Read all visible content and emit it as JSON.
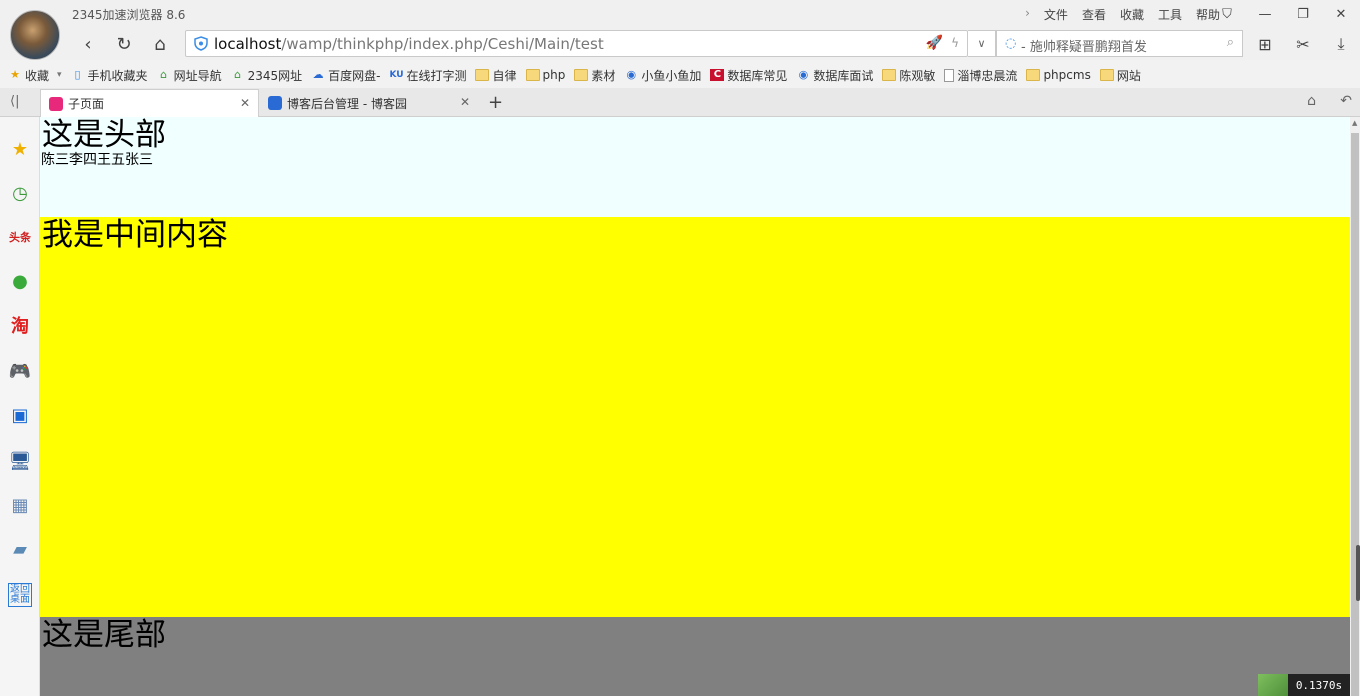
{
  "app": {
    "title": "2345加速浏览器 8.6",
    "menu": [
      "文件",
      "查看",
      "收藏",
      "工具",
      "帮助"
    ],
    "window_controls": [
      "shirt-icon",
      "minimize-icon",
      "restore-icon",
      "close-icon"
    ]
  },
  "nav": {
    "url_host": "localhost",
    "url_path": "/wamp/thinkphp/index.php/Ceshi/Main/test",
    "search_placeholder": "- 施帅释疑晋鹏翔首发"
  },
  "bookmarks": [
    {
      "label": "收藏",
      "icon": "star-icon"
    },
    {
      "label": "手机收藏夹",
      "icon": "phone-icon"
    },
    {
      "label": "网址导航",
      "icon": "home-icon"
    },
    {
      "label": "2345网址",
      "icon": "home-icon"
    },
    {
      "label": "百度网盘-",
      "icon": "cloud-icon"
    },
    {
      "label": "在线打字测",
      "icon": "ku-icon"
    },
    {
      "label": "自律",
      "icon": "folder-icon"
    },
    {
      "label": "php",
      "icon": "folder-icon"
    },
    {
      "label": "素材",
      "icon": "folder-icon"
    },
    {
      "label": "小鱼小鱼加",
      "icon": "globe-icon"
    },
    {
      "label": "数据库常见",
      "icon": "c-icon"
    },
    {
      "label": "数据库面试",
      "icon": "globe-icon"
    },
    {
      "label": "陈观敏",
      "icon": "folder-icon"
    },
    {
      "label": "淄博忠晨流",
      "icon": "page-icon"
    },
    {
      "label": "phpcms",
      "icon": "folder-icon"
    },
    {
      "label": "网站",
      "icon": "folder-icon"
    }
  ],
  "tabs": [
    {
      "label": "子页面",
      "active": true
    },
    {
      "label": "博客后台管理 - 博客园",
      "active": false
    }
  ],
  "page": {
    "header_title": "这是头部",
    "header_names": "陈三李四王五张三",
    "middle_title": "我是中间内容",
    "footer_title": "这是尾部",
    "header_bg": "#f0ffff",
    "middle_bg": "#ffff00",
    "footer_bg": "#808080"
  },
  "trace_time": "0.1370s"
}
